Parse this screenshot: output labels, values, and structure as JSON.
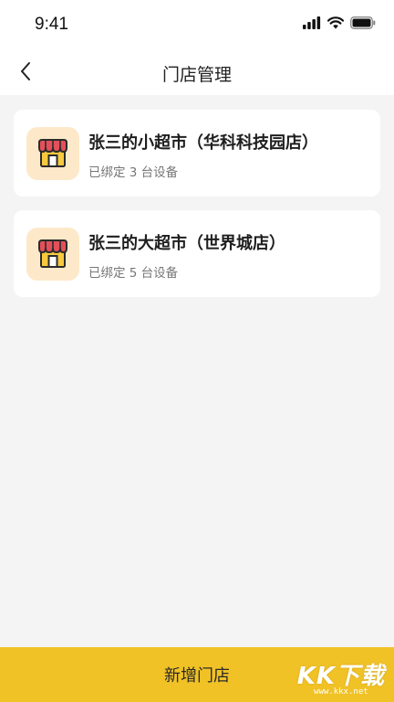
{
  "status_bar": {
    "time": "9:41",
    "icons": [
      "signal-icon",
      "wifi-icon",
      "battery-icon"
    ]
  },
  "header": {
    "title": "门店管理",
    "back_icon": "chevron-left-icon"
  },
  "stores": [
    {
      "name": "张三的小超市（华科科技园店）",
      "devices": "已绑定 3 台设备",
      "icon": "store-icon"
    },
    {
      "name": "张三的大超市（世界城店）",
      "devices": "已绑定 5 台设备",
      "icon": "store-icon"
    }
  ],
  "footer": {
    "add_label": "新增门店"
  },
  "watermark": {
    "brand": "KK下载",
    "url": "www.kkx.net"
  },
  "colors": {
    "accent": "#f1c226",
    "background": "#f4f4f4",
    "card": "#ffffff",
    "icon_bg": "#fde9c9",
    "awning_red": "#e4505a",
    "shop_yellow": "#f7c93e"
  }
}
